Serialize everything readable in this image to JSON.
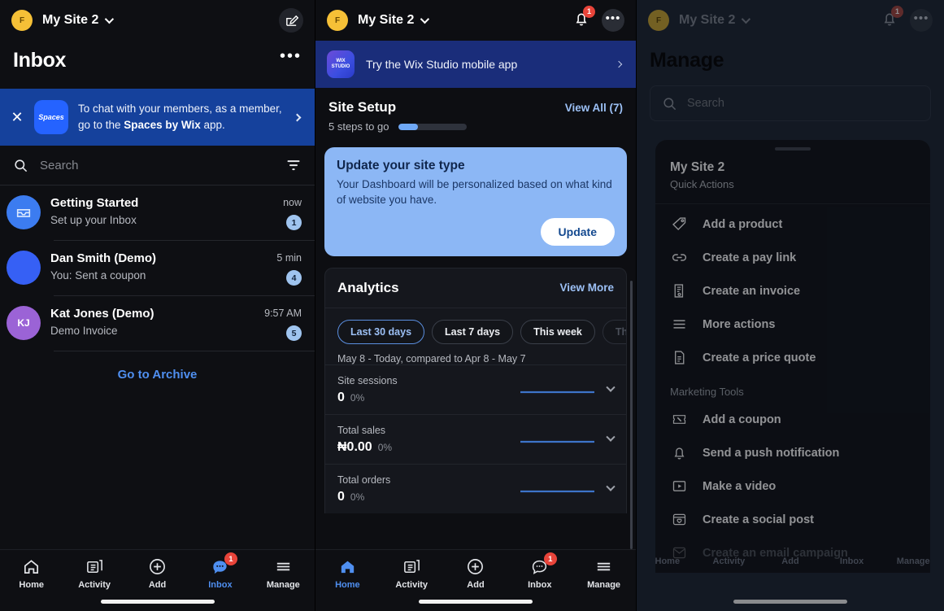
{
  "accent": "#4f8ff0",
  "badge_red": "#e8443a",
  "badge_blue": "#9fc4ef",
  "inbox_panel": {
    "topbar": {
      "avatar_initial": "F",
      "site_name": "My Site 2",
      "compose_icon": "compose-icon",
      "more_icon": "ellipsis-icon"
    },
    "page_title": "Inbox",
    "banner": {
      "close_icon": "close-icon",
      "logo_label": "Spaces",
      "text_part1": "To chat with your members, as a member, go to the ",
      "text_bold": "Spaces by Wix",
      "text_part2": " app.",
      "chevron_icon": "chevron-right-icon"
    },
    "search": {
      "placeholder": "Search",
      "value": "",
      "search_icon": "search-icon",
      "filter_icon": "filter-icon"
    },
    "conversations": [
      {
        "avatar_text": "",
        "avatar_icon": "inbox-tray-icon",
        "avatar_color": "#3c7cf0",
        "title": "Getting Started",
        "subtitle": "Set up your Inbox",
        "time": "now",
        "count": "1"
      },
      {
        "avatar_text": "",
        "avatar_icon": "user-avatar",
        "avatar_color": "#3660f5",
        "title": "Dan Smith (Demo)",
        "subtitle": "You: Sent a coupon",
        "time": "5 min",
        "count": "4"
      },
      {
        "avatar_text": "KJ",
        "avatar_icon": "user-avatar",
        "avatar_color": "#9b63d6",
        "title": "Kat Jones (Demo)",
        "subtitle": "Demo Invoice",
        "time": "9:57 AM",
        "count": "5"
      }
    ],
    "archive_link": "Go to Archive",
    "bottom_nav": [
      {
        "label": "Home",
        "icon": "home-icon",
        "active": false,
        "badge": ""
      },
      {
        "label": "Activity",
        "icon": "activity-icon",
        "active": false,
        "badge": ""
      },
      {
        "label": "Add",
        "icon": "plus-circle-icon",
        "active": false,
        "badge": ""
      },
      {
        "label": "Inbox",
        "icon": "chat-bubble-icon",
        "active": true,
        "badge": "1"
      },
      {
        "label": "Manage",
        "icon": "hamburger-icon",
        "active": false,
        "badge": ""
      }
    ]
  },
  "home_panel": {
    "topbar": {
      "avatar_initial": "F",
      "site_name": "My Site 2",
      "bell_icon": "bell-icon",
      "bell_badge": "1",
      "more_icon": "ellipsis-icon"
    },
    "studio_banner": {
      "logo_label": "WIX STUDIO",
      "text": "Try the Wix Studio mobile app",
      "chevron_icon": "chevron-right-icon"
    },
    "site_setup": {
      "title": "Site Setup",
      "view_all": "View All (7)",
      "steps_text": "5 steps to go",
      "progress_percent": 28
    },
    "update_card": {
      "title": "Update your site type",
      "subtitle": "Your Dashboard will be personalized based on what kind of website you have.",
      "button_label": "Update"
    },
    "analytics": {
      "title": "Analytics",
      "view_more": "View More",
      "chips": [
        {
          "label": "Last 30 days",
          "selected": true,
          "faded": false
        },
        {
          "label": "Last 7 days",
          "selected": false,
          "faded": false
        },
        {
          "label": "This week",
          "selected": false,
          "faded": false
        },
        {
          "label": "This mo",
          "selected": false,
          "faded": true
        }
      ],
      "range_text": "May 8 - Today, compared to Apr 8 - May 7",
      "metrics": [
        {
          "name": "Site sessions",
          "value": "0",
          "delta": "0%",
          "chevron_icon": "chevron-down-icon"
        },
        {
          "name": "Total sales",
          "value": "₦0.00",
          "delta": "0%",
          "chevron_icon": "chevron-down-icon"
        },
        {
          "name": "Total orders",
          "value": "0",
          "delta": "0%",
          "chevron_icon": "chevron-down-icon"
        }
      ]
    },
    "bottom_nav": [
      {
        "label": "Home",
        "icon": "home-icon",
        "active": true,
        "badge": ""
      },
      {
        "label": "Activity",
        "icon": "activity-icon",
        "active": false,
        "badge": ""
      },
      {
        "label": "Add",
        "icon": "plus-circle-icon",
        "active": false,
        "badge": ""
      },
      {
        "label": "Inbox",
        "icon": "chat-bubble-icon",
        "active": false,
        "badge": "1"
      },
      {
        "label": "Manage",
        "icon": "hamburger-icon",
        "active": false,
        "badge": ""
      }
    ]
  },
  "manage_panel": {
    "topbar": {
      "avatar_initial": "F",
      "site_name": "My Site 2",
      "bell_icon": "bell-icon",
      "bell_badge": "1",
      "more_icon": "ellipsis-icon"
    },
    "page_title": "Manage",
    "search": {
      "placeholder": "Search",
      "value": "",
      "search_icon": "search-icon"
    },
    "sheet": {
      "drag_handle": "drag-handle",
      "title": "My Site 2",
      "subtitle": "Quick Actions",
      "actions": [
        {
          "label": "Add a product",
          "icon": "tag-icon",
          "dim": false
        },
        {
          "label": "Create a pay link",
          "icon": "link-icon",
          "dim": false
        },
        {
          "label": "Create an invoice",
          "icon": "invoice-icon",
          "dim": false
        },
        {
          "label": "More actions",
          "icon": "hamburger-icon",
          "dim": false
        },
        {
          "label": "Create a price quote",
          "icon": "document-icon",
          "dim": false
        }
      ],
      "section_label": "Marketing Tools",
      "marketing_actions": [
        {
          "label": "Add a coupon",
          "icon": "coupon-percent-icon",
          "dim": false
        },
        {
          "label": "Send a push notification",
          "icon": "bell-icon",
          "dim": false
        },
        {
          "label": "Make a video",
          "icon": "video-play-icon",
          "dim": false
        },
        {
          "label": "Create a social post",
          "icon": "social-post-icon",
          "dim": false
        },
        {
          "label": "Create an email campaign",
          "icon": "email-campaign-icon",
          "dim": true
        }
      ]
    },
    "bottom_nav": [
      {
        "label": "Home",
        "icon": "home-icon",
        "active": false,
        "badge": ""
      },
      {
        "label": "Activity",
        "icon": "activity-icon",
        "active": false,
        "badge": ""
      },
      {
        "label": "Add",
        "icon": "plus-circle-icon",
        "active": false,
        "badge": ""
      },
      {
        "label": "Inbox",
        "icon": "chat-bubble-icon",
        "active": false,
        "badge": ""
      },
      {
        "label": "Manage",
        "icon": "hamburger-icon",
        "active": false,
        "badge": ""
      }
    ]
  }
}
